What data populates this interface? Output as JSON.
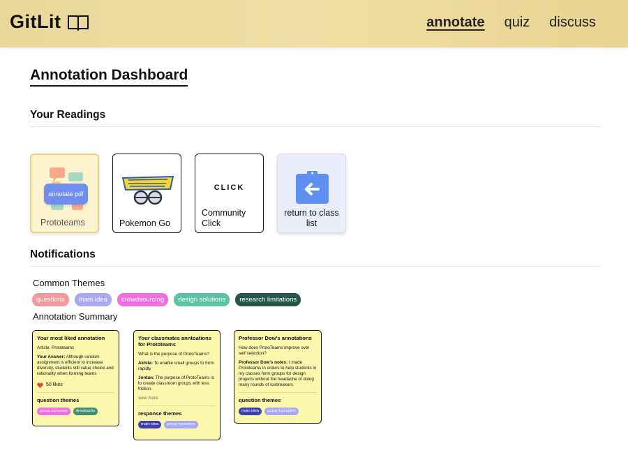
{
  "app": {
    "name": "GitLit"
  },
  "nav": {
    "annotate": "annotate",
    "quiz": "quiz",
    "discuss": "discuss"
  },
  "page": {
    "title": "Annotation Dashboard"
  },
  "readings": {
    "title": "Your Readings",
    "items": [
      {
        "label": "Prototeams",
        "button": "annotate pdf"
      },
      {
        "label": "Pokemon Go"
      },
      {
        "label": "Community Click",
        "logo_text": "CLICK"
      },
      {
        "label": "return to class list"
      }
    ]
  },
  "notifications": {
    "title": "Notifications",
    "common_themes_title": "Common Themes",
    "themes": [
      {
        "label": "questions",
        "color": "#f29a9a"
      },
      {
        "label": "main idea",
        "color": "#a9a8f2"
      },
      {
        "label": "crowdsourcing",
        "color": "#ef6fe0"
      },
      {
        "label": "design solutions",
        "color": "#5cc2a3"
      },
      {
        "label": "research limitations",
        "color": "#24574a"
      }
    ],
    "summary_title": "Annotation Summary"
  },
  "cards": {
    "liked": {
      "title": "Your most liked annotation",
      "article_label": "Article:",
      "article": "Prototeams",
      "answer_label": "Your Answer:",
      "answer": "Although random assignment is efficient to increase diversity, students still value choice and rationality when forming teams",
      "likes": "50 likes",
      "themes_title": "question themes",
      "chips": [
        {
          "label": "group cohesion",
          "color": "#ef6fe0"
        },
        {
          "label": "drawbacks",
          "color": "#3f8f74"
        }
      ]
    },
    "classmates": {
      "title": "Your classmates anntoations for Prototeams",
      "question": "What is the purpose of ProtoTeams?",
      "a1_name": "Akhila:",
      "a1_text": "To enable small groups to form rapidly",
      "a2_name": "Jordan:",
      "a2_text": "The purpose of ProtoTeams is to create classroom groups with less friction.",
      "view_more": "view more",
      "themes_title": "response themes",
      "chips": [
        {
          "label": "main idea",
          "color": "#3e3fb0"
        },
        {
          "label": "group formation",
          "color": "#a9a8f2"
        }
      ]
    },
    "professor": {
      "title": "Professor Dow's annotations",
      "question": "How does ProtoTeams improve over self selection?",
      "notes_label": "Professor Dow's notes:",
      "notes": "I made Prototeams in orders to help students in my classes form groups for design projects without the headache of doing many rounds of icebreakers.",
      "themes_title": "question themes",
      "chips": [
        {
          "label": "main idea",
          "color": "#3e3fb0"
        },
        {
          "label": "group formation",
          "color": "#a9a8f2"
        }
      ]
    }
  }
}
